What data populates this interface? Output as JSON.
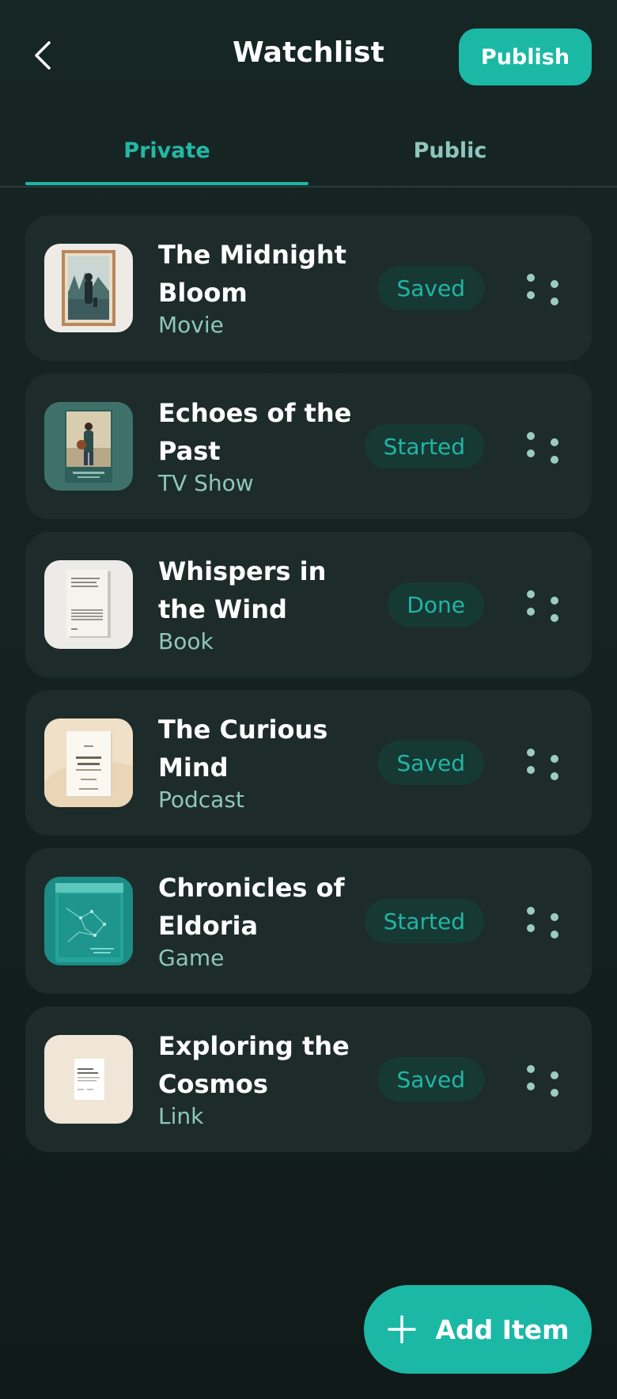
{
  "header": {
    "title": "Watchlist",
    "publish_label": "Publish",
    "back_icon": "chevron-left-icon"
  },
  "tabs": [
    {
      "label": "Private",
      "active": true
    },
    {
      "label": "Public",
      "active": false
    }
  ],
  "items": [
    {
      "title": "The Midnight Bloom",
      "type": "Movie",
      "status": "Saved",
      "thumbnail": "movie-poster-thumbnail"
    },
    {
      "title": "Echoes of the Past",
      "type": "TV Show",
      "status": "Started",
      "thumbnail": "tv-show-poster-thumbnail"
    },
    {
      "title": "Whispers in the Wind",
      "type": "Book",
      "status": "Done",
      "thumbnail": "book-cover-thumbnail"
    },
    {
      "title": "The Curious Mind",
      "type": "Podcast",
      "status": "Saved",
      "thumbnail": "podcast-cover-thumbnail"
    },
    {
      "title": "Chronicles of Eldoria",
      "type": "Game",
      "status": "Started",
      "thumbnail": "game-cover-thumbnail"
    },
    {
      "title": "Exploring the Cosmos",
      "type": "Link",
      "status": "Saved",
      "thumbnail": "link-page-thumbnail"
    }
  ],
  "add_button": {
    "label": "Add Item",
    "icon": "plus-icon"
  },
  "colors": {
    "accent": "#1bb8a6",
    "background": "#13201f",
    "card": "#1d2c2a",
    "status_bg": "#173934",
    "muted_text": "#8fc6bd"
  }
}
